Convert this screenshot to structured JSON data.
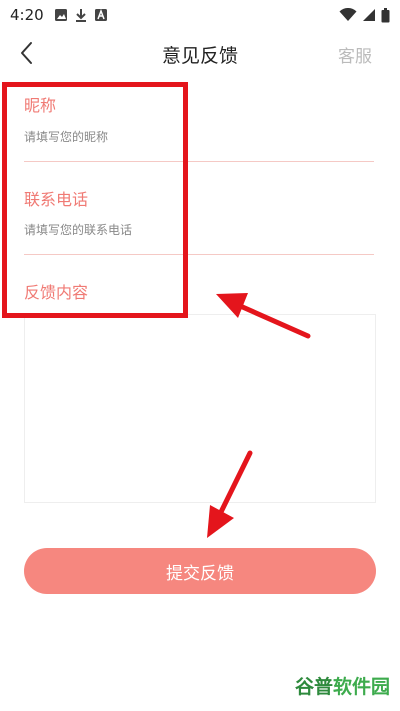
{
  "status_bar": {
    "time": "4:20",
    "left_icons": [
      "gallery-icon",
      "download-icon",
      "app-icon"
    ],
    "right_icons": [
      "wifi-icon",
      "signal-icon",
      "battery-icon"
    ]
  },
  "nav": {
    "back_icon": "chevron-left-icon",
    "title": "意见反馈",
    "service_label": "客服"
  },
  "form": {
    "nickname": {
      "label": "昵称",
      "value": "",
      "placeholder": "请填写您的昵称"
    },
    "phone": {
      "label": "联系电话",
      "value": "",
      "placeholder": "请填写您的联系电话"
    },
    "content": {
      "label": "反馈内容",
      "value": ""
    }
  },
  "submit_label": "提交反馈",
  "annotation": {
    "box_color": "#e4151c",
    "arrow_color": "#e4151c"
  },
  "watermark": {
    "part1": "谷普",
    "part2": "软件园"
  },
  "colors": {
    "accent": "#f07a74",
    "button": "#f6877f",
    "divider": "#f5c9c5",
    "service_text": "#bbbbbb",
    "watermark": "#2e8a3d"
  }
}
